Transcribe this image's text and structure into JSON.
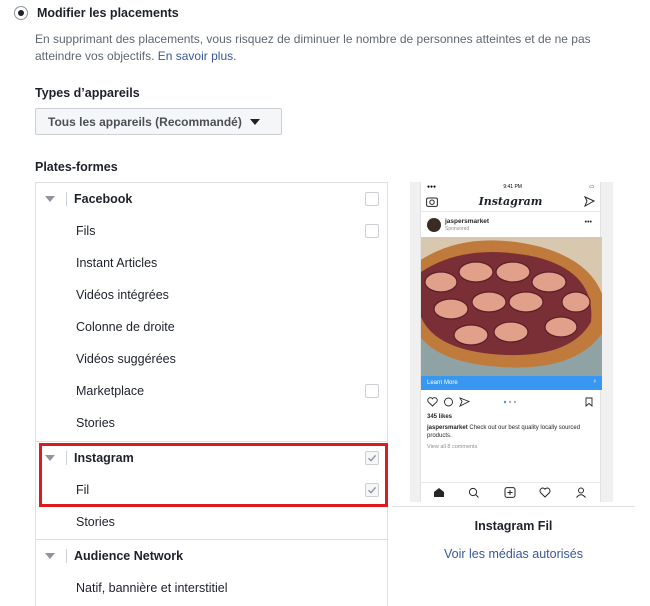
{
  "placement": {
    "radio_label": "Modifier les placements",
    "description": "En supprimant des placements, vous risquez de diminuer le nombre de personnes atteintes et de ne pas atteindre vos objectifs.",
    "learn_more": "En savoir plus."
  },
  "devices": {
    "label": "Types d’appareils",
    "selected": "Tous les appareils (Recommandé)"
  },
  "platforms": {
    "label": "Plates-formes",
    "facebook": {
      "name": "Facebook",
      "items": [
        "Fils",
        "Instant Articles",
        "Vidéos intégrées",
        "Colonne de droite",
        "Vidéos suggérées",
        "Marketplace",
        "Stories"
      ]
    },
    "instagram": {
      "name": "Instagram",
      "items": [
        "Fil",
        "Stories"
      ]
    },
    "audience_network": {
      "name": "Audience Network",
      "items": [
        "Natif, bannière et interstitiel"
      ]
    }
  },
  "preview": {
    "status_time": "9:41 PM",
    "app_title": "Instagram",
    "username": "jaspersmarket",
    "sponsored": "Sponsored",
    "cta": "Learn More",
    "likes": "345 likes",
    "caption_user": "jaspersmarket",
    "caption_text": "Check out our best quality locally sourced products.",
    "comments": "View all 8 comments",
    "caption": "Instagram Fil",
    "link": "Voir les médias autorisés"
  },
  "colors": {
    "link": "#385898",
    "highlight": "#e0191f",
    "cta": "#3897f0"
  }
}
